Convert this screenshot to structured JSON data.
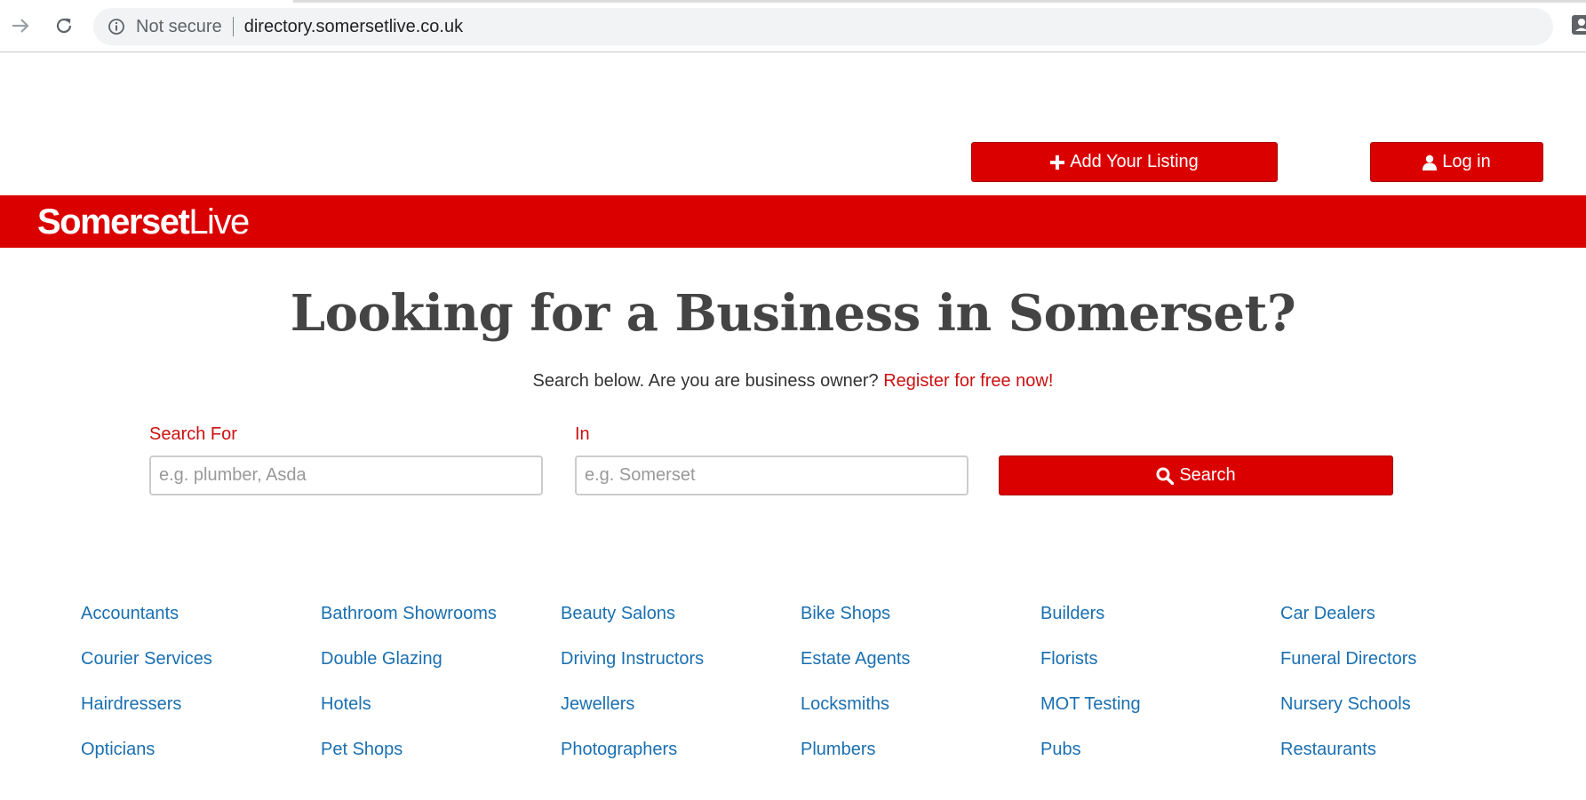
{
  "browser": {
    "security_label": "Not secure",
    "url": "directory.somersetlive.co.uk"
  },
  "header": {
    "add_listing_label": "Add Your Listing",
    "login_label": "Log in"
  },
  "banner": {
    "logo_bold": "Somerset",
    "logo_light": "Live",
    "color": "#db0000"
  },
  "hero": {
    "title": "Looking for a Business in Somerset?",
    "subtitle": "Search below. Are you are business owner?",
    "register_link": "Register for free now!"
  },
  "search": {
    "for_label": "Search For",
    "for_placeholder": "e.g. plumber, Asda",
    "in_label": "In",
    "in_placeholder": "e.g. Somerset",
    "button_label": "Search"
  },
  "categories": [
    [
      "Accountants",
      "Bathroom Showrooms",
      "Beauty Salons",
      "Bike Shops",
      "Builders",
      "Car Dealers"
    ],
    [
      "Courier Services",
      "Double Glazing",
      "Driving Instructors",
      "Estate Agents",
      "Florists",
      "Funeral Directors"
    ],
    [
      "Hairdressers",
      "Hotels",
      "Jewellers",
      "Locksmiths",
      "MOT Testing",
      "Nursery Schools"
    ],
    [
      "Opticians",
      "Pet Shops",
      "Photographers",
      "Plumbers",
      "Pubs",
      "Restaurants"
    ]
  ],
  "colors": {
    "accent": "#db0000",
    "link": "#1a6fb0",
    "label": "#cc1111",
    "heading": "#444444"
  }
}
